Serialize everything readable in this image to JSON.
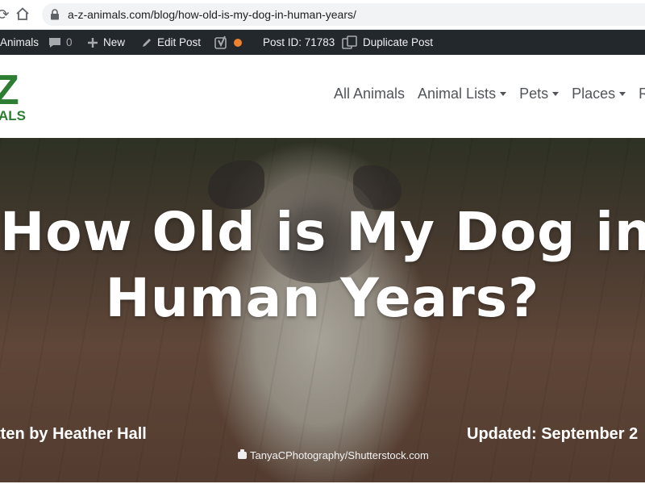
{
  "browser": {
    "url": "a-z-animals.com/blog/how-old-is-my-dog-in-human-years/"
  },
  "admin_bar": {
    "site_name": "Animals",
    "comments_count": "0",
    "new_label": "New",
    "edit_post_label": "Edit Post",
    "post_id_label": "Post ID: 71783",
    "duplicate_post_label": "Duplicate Post",
    "seo_status_color": "#f0812d"
  },
  "site_header": {
    "logo_top": "Z",
    "logo_bottom": "ALS",
    "logo_color": "#2d7d32",
    "menu": [
      {
        "label": "All Animals",
        "has_dropdown": false
      },
      {
        "label": "Animal Lists",
        "has_dropdown": true
      },
      {
        "label": "Pets",
        "has_dropdown": true
      },
      {
        "label": "Places",
        "has_dropdown": true
      },
      {
        "label": "Re",
        "has_dropdown": false
      }
    ]
  },
  "hero": {
    "title_line1": "How Old is My Dog in",
    "title_line2": "Human Years?",
    "byline": "tten by Heather Hall",
    "updated": "Updated: September 2",
    "photo_credit": "TanyaCPhotography/Shutterstock.com"
  }
}
